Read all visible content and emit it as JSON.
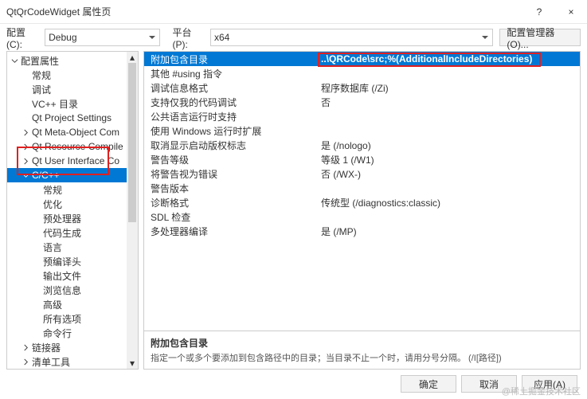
{
  "window": {
    "title": "QtQrCodeWidget 属性页",
    "help": "?",
    "close": "×"
  },
  "toolbar": {
    "config_label": "配置(C):",
    "config_value": "Debug",
    "platform_label": "平台(P):",
    "platform_value": "x64",
    "manager": "配置管理器(O)..."
  },
  "tree": [
    {
      "label": "配置属性",
      "depth": 0,
      "tw": "down"
    },
    {
      "label": "常规",
      "depth": 1
    },
    {
      "label": "调试",
      "depth": 1
    },
    {
      "label": "VC++ 目录",
      "depth": 1
    },
    {
      "label": "Qt Project Settings",
      "depth": 1
    },
    {
      "label": "Qt Meta-Object Com",
      "depth": 1,
      "tw": "right"
    },
    {
      "label": "Qt Resource Compile",
      "depth": 1,
      "tw": "right"
    },
    {
      "label": "Qt User Interface Co",
      "depth": 1,
      "tw": "right"
    },
    {
      "label": "C/C++",
      "depth": 1,
      "tw": "down",
      "selected": true
    },
    {
      "label": "常规",
      "depth": 2
    },
    {
      "label": "优化",
      "depth": 2
    },
    {
      "label": "预处理器",
      "depth": 2
    },
    {
      "label": "代码生成",
      "depth": 2
    },
    {
      "label": "语言",
      "depth": 2
    },
    {
      "label": "预编译头",
      "depth": 2
    },
    {
      "label": "输出文件",
      "depth": 2
    },
    {
      "label": "浏览信息",
      "depth": 2
    },
    {
      "label": "高级",
      "depth": 2
    },
    {
      "label": "所有选项",
      "depth": 2
    },
    {
      "label": "命令行",
      "depth": 2
    },
    {
      "label": "链接器",
      "depth": 1,
      "tw": "right"
    },
    {
      "label": "清单工具",
      "depth": 1,
      "tw": "right"
    }
  ],
  "grid": [
    {
      "label": "附加包含目录",
      "value": "..\\QRCode\\src;%(AdditionalIncludeDirectories)",
      "selected": true,
      "bold": true
    },
    {
      "label": "其他 #using 指令",
      "value": ""
    },
    {
      "label": "调试信息格式",
      "value": "程序数据库 (/Zi)"
    },
    {
      "label": "支持仅我的代码调试",
      "value": "否"
    },
    {
      "label": "公共语言运行时支持",
      "value": ""
    },
    {
      "label": "使用 Windows 运行时扩展",
      "value": ""
    },
    {
      "label": "取消显示启动版权标志",
      "value": "是 (/nologo)"
    },
    {
      "label": "警告等级",
      "value": "等级 1 (/W1)"
    },
    {
      "label": "将警告视为错误",
      "value": "否 (/WX-)"
    },
    {
      "label": "警告版本",
      "value": ""
    },
    {
      "label": "诊断格式",
      "value": "传统型 (/diagnostics:classic)"
    },
    {
      "label": "SDL 检查",
      "value": ""
    },
    {
      "label": "多处理器编译",
      "value": "是 (/MP)"
    }
  ],
  "desc": {
    "title": "附加包含目录",
    "text": "指定一个或多个要添加到包含路径中的目录；当目录不止一个时，请用分号分隔。     (/I[路径])"
  },
  "footer": {
    "ok": "确定",
    "cancel": "取消",
    "apply": "应用(A)"
  },
  "watermark": "@稀土掘金技术社区"
}
